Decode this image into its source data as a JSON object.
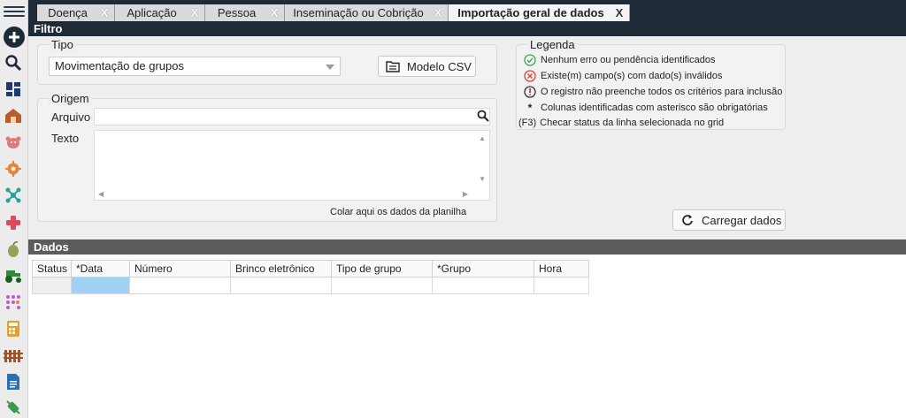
{
  "sidebar": {
    "items": [
      {
        "icon": "add-icon"
      },
      {
        "icon": "search-icon"
      },
      {
        "icon": "dashboard-icon"
      },
      {
        "icon": "barn-icon"
      },
      {
        "icon": "cow-icon"
      },
      {
        "icon": "gear-icon"
      },
      {
        "icon": "network-icon"
      },
      {
        "icon": "health-cross-icon"
      },
      {
        "icon": "seed-icon"
      },
      {
        "icon": "tractor-icon"
      },
      {
        "icon": "dots-pattern-icon"
      },
      {
        "icon": "calculator-icon"
      },
      {
        "icon": "fence-icon"
      },
      {
        "icon": "document-icon"
      },
      {
        "icon": "vaccine-icon"
      }
    ]
  },
  "tabs": [
    {
      "label": "Doença",
      "close": "X"
    },
    {
      "label": "Aplicação",
      "close": "X"
    },
    {
      "label": "Pessoa",
      "close": "X"
    },
    {
      "label": "Inseminação ou Cobrição",
      "close": "X"
    },
    {
      "label": "Importação geral de dados",
      "close": "X"
    }
  ],
  "filtro": {
    "title": "Filtro",
    "tipo": {
      "label": "Tipo",
      "selected": "Movimentação de grupos"
    },
    "modelo_button": "Modelo CSV",
    "origem": {
      "label": "Origem",
      "arquivo_label": "Arquivo",
      "arquivo_value": "",
      "texto_label": "Texto",
      "texto_value": "",
      "hint": "Colar aqui os dados da planilha"
    },
    "legenda": {
      "title": "Legenda",
      "items": [
        {
          "icon": "check-circle-icon",
          "text": "Nenhum erro ou pendência identificados"
        },
        {
          "icon": "error-circle-icon",
          "text": "Existe(m) campo(s) com dado(s) inválidos"
        },
        {
          "icon": "warning-circle-icon",
          "text": "O registro não  preenche todos os critérios para inclusão"
        },
        {
          "icon": "asterisk-icon",
          "text": "Colunas identificadas com asterisco são obrigatórias"
        },
        {
          "icon": "",
          "prefix": "(F3)",
          "text": "Checar status da linha selecionada no grid"
        }
      ]
    },
    "carregar_button": "Carregar dados"
  },
  "dados": {
    "title": "Dados",
    "columns": [
      "Status",
      "*Data",
      "Número",
      "Brinco eletrônico",
      "Tipo de grupo",
      "*Grupo",
      "Hora"
    ],
    "rows": [
      [
        "",
        "",
        "",
        "",
        "",
        "",
        ""
      ]
    ]
  },
  "colors": {
    "tabbar": "#1e2b36",
    "section_dark": "#1e2b36",
    "section_grey": "#5c5c5c",
    "selected_cell": "#9fd2f5"
  }
}
